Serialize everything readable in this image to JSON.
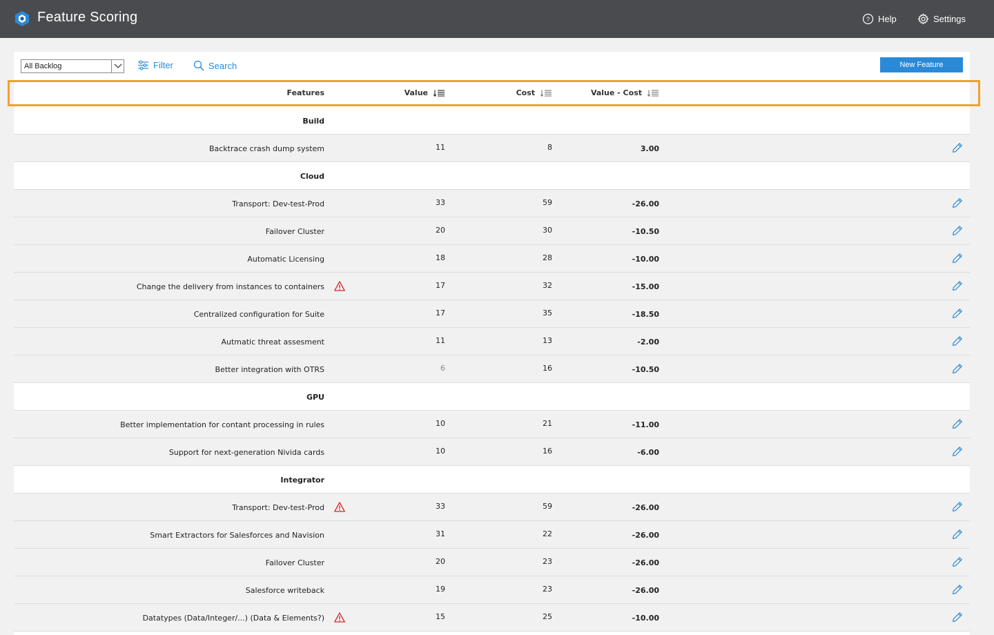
{
  "app": {
    "title": "Feature Scoring",
    "help_label": "Help",
    "settings_label": "Settings"
  },
  "toolbar": {
    "backlog_selected": "All Backlog",
    "filter_label": "Filter",
    "search_label": "Search",
    "new_feature_label": "New Feature"
  },
  "columns": {
    "features": "Features",
    "value": "Value",
    "cost": "Cost",
    "value_minus_cost": "Value - Cost"
  },
  "colors": {
    "accent": "#2a8ad8",
    "topbar": "#4a4b4f",
    "highlight": "#f0a12a",
    "warning": "#d9262c"
  },
  "rows": [
    {
      "kind": "group",
      "label": "Build"
    },
    {
      "kind": "data",
      "feature": "Backtrace crash dump system",
      "value": "11",
      "cost": "8",
      "diff": "3.00",
      "warning": false
    },
    {
      "kind": "group",
      "label": "Cloud"
    },
    {
      "kind": "data",
      "feature": "Transport: Dev-test-Prod",
      "value": "33",
      "cost": "59",
      "diff": "-26.00",
      "warning": false
    },
    {
      "kind": "data",
      "feature": "Failover Cluster",
      "value": "20",
      "cost": "30",
      "diff": "-10.50",
      "warning": false
    },
    {
      "kind": "data",
      "feature": "Automatic Licensing",
      "value": "18",
      "cost": "28",
      "diff": "-10.00",
      "warning": false
    },
    {
      "kind": "data",
      "feature": "Change the delivery from instances to containers",
      "value": "17",
      "cost": "32",
      "diff": "-15.00",
      "warning": true
    },
    {
      "kind": "data",
      "feature": "Centralized configuration for Suite",
      "value": "17",
      "cost": "35",
      "diff": "-18.50",
      "warning": false
    },
    {
      "kind": "data",
      "feature": "Autmatic threat assesment",
      "value": "11",
      "cost": "13",
      "diff": "-2.00",
      "warning": false
    },
    {
      "kind": "data",
      "feature": "Better integration with OTRS",
      "value": "6",
      "cost": "16",
      "diff": "-10.50",
      "warning": false,
      "muted_value": true
    },
    {
      "kind": "group",
      "label": "GPU"
    },
    {
      "kind": "data",
      "feature": "Better implementation for contant processing in rules",
      "value": "10",
      "cost": "21",
      "diff": "-11.00",
      "warning": false
    },
    {
      "kind": "data",
      "feature": "Support for next-generation Nivida cards",
      "value": "10",
      "cost": "16",
      "diff": "-6.00",
      "warning": false
    },
    {
      "kind": "group",
      "label": "Integrator"
    },
    {
      "kind": "data",
      "feature": "Transport: Dev-test-Prod",
      "value": "33",
      "cost": "59",
      "diff": "-26.00",
      "warning": true
    },
    {
      "kind": "data",
      "feature": "Smart Extractors for Salesforces and Navision",
      "value": "31",
      "cost": "22",
      "diff": "-26.00",
      "warning": false
    },
    {
      "kind": "data",
      "feature": "Failover Cluster",
      "value": "20",
      "cost": "23",
      "diff": "-26.00",
      "warning": false
    },
    {
      "kind": "data",
      "feature": "Salesforce writeback",
      "value": "19",
      "cost": "23",
      "diff": "-26.00",
      "warning": false
    },
    {
      "kind": "data",
      "feature": "Datatypes (Data/Integer/...) (Data & Elements?)",
      "value": "15",
      "cost": "25",
      "diff": "-10.00",
      "warning": true
    }
  ]
}
